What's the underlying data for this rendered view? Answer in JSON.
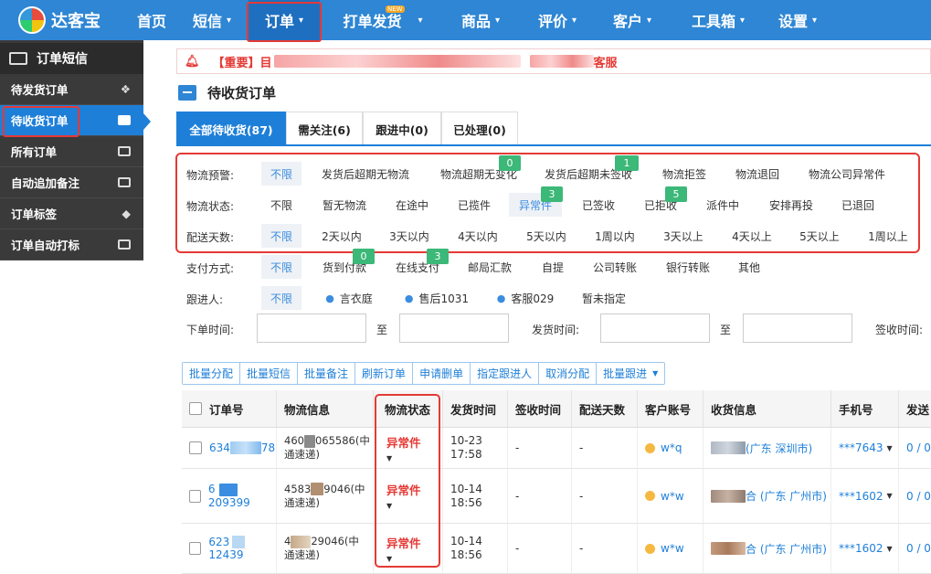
{
  "app": {
    "logo_text": "达客宝"
  },
  "nav": {
    "items": [
      {
        "label": "首页",
        "caret": ""
      },
      {
        "label": "短信",
        "caret": "▾"
      },
      {
        "label": "订单",
        "caret": "▾"
      },
      {
        "label": "打单发货",
        "caret": "▾",
        "badge": "NEW"
      },
      {
        "label": "商品",
        "caret": "▾"
      },
      {
        "label": "评价",
        "caret": "▾"
      },
      {
        "label": "客户",
        "caret": "▾"
      },
      {
        "label": "工具箱",
        "caret": "▾"
      },
      {
        "label": "设置",
        "caret": "▾"
      }
    ]
  },
  "sidebar": {
    "header": "订单短信",
    "items": [
      {
        "label": "待发货订单",
        "icon": "cubes-icon"
      },
      {
        "label": "待收货订单",
        "icon": "box-icon"
      },
      {
        "label": "所有订单",
        "icon": "card-icon"
      },
      {
        "label": "自动追加备注",
        "icon": "list-icon"
      },
      {
        "label": "订单标签",
        "icon": "tag-icon"
      },
      {
        "label": "订单自动打标",
        "icon": "monitor-icon"
      }
    ]
  },
  "notice": {
    "prefix": "【重要】目",
    "suffix": "客服"
  },
  "page": {
    "title": "待收货订单"
  },
  "tabs": [
    {
      "label": "全部待收货(87)"
    },
    {
      "label": "需关注(6)"
    },
    {
      "label": "跟进中(0)"
    },
    {
      "label": "已处理(0)"
    }
  ],
  "filters": {
    "warning": {
      "label": "物流预警:",
      "options": [
        "不限",
        "发货后超期无物流",
        "物流超期无变化",
        "发货后超期未签收",
        "物流拒签",
        "物流退回",
        "物流公司异常件"
      ],
      "badges": [
        "0",
        "1"
      ]
    },
    "status": {
      "label": "物流状态:",
      "options": [
        "不限",
        "暂无物流",
        "在途中",
        "已揽件",
        "异常件",
        "已签收",
        "已拒收",
        "派件中",
        "安排再投",
        "已退回"
      ],
      "badges": [
        "3",
        "5"
      ]
    },
    "days": {
      "label": "配送天数:",
      "options": [
        "不限",
        "2天以内",
        "3天以内",
        "4天以内",
        "5天以内",
        "1周以内",
        "3天以上",
        "4天以上",
        "5天以上",
        "1周以上"
      ]
    },
    "payment": {
      "label": "支付方式:",
      "options": [
        "不限",
        "货到付款",
        "在线支付",
        "邮局汇款",
        "自提",
        "公司转账",
        "银行转账",
        "其他"
      ],
      "badges": [
        "0",
        "3"
      ]
    },
    "follower": {
      "label": "跟进人:",
      "options": [
        "不限",
        "言衣庭",
        "售后1031",
        "客服029",
        "暂未指定"
      ]
    },
    "order_time": {
      "label": "下单时间:",
      "to": "至"
    },
    "ship_time": {
      "label": "发货时间:",
      "to": "至"
    },
    "sign_time": {
      "label": "签收时间:"
    }
  },
  "bulk_actions": [
    "批量分配",
    "批量短信",
    "批量备注",
    "刷新订单",
    "申请删单",
    "指定跟进人",
    "取消分配",
    "批量跟进"
  ],
  "table": {
    "headers": [
      "订单号",
      "物流信息",
      "物流状态",
      "发货时间",
      "签收时间",
      "配送天数",
      "客户账号",
      "收货信息",
      "手机号",
      "发送"
    ],
    "rows": [
      {
        "order_prefix": "634",
        "order_suffix": "78",
        "logi_prefix": "460",
        "logi_suffix": "065586(中",
        "logi_line2": "通速递)",
        "status": "异常件",
        "ship_date": "10-23",
        "ship_time": "17:58",
        "sign": "-",
        "days": "-",
        "account": "w*q",
        "addr_prefix": "",
        "addr_suffix": "(广东 深圳市)",
        "phone": "***7643",
        "send": "0 / 0"
      },
      {
        "order_prefix": "6",
        "order_suffix": "209399",
        "logi_prefix": "4583",
        "logi_suffix": "9046(中",
        "logi_line2": "通速递)",
        "status": "异常件",
        "ship_date": "10-14",
        "ship_time": "18:56",
        "sign": "-",
        "days": "-",
        "account": "w*w",
        "addr_prefix": "",
        "addr_suffix": "合 (广东 广州市)",
        "phone": "***1602",
        "send": "0 / 0"
      },
      {
        "order_prefix": "623",
        "order_suffix": "12439",
        "logi_prefix": "4",
        "logi_suffix": "29046(中",
        "logi_line2": "通速递)",
        "status": "异常件",
        "ship_date": "10-14",
        "ship_time": "18:56",
        "sign": "-",
        "days": "-",
        "account": "w*w",
        "addr_prefix": "",
        "addr_suffix": "合 (广东 广州市)",
        "phone": "***1602",
        "send": "0 / 0"
      }
    ]
  }
}
